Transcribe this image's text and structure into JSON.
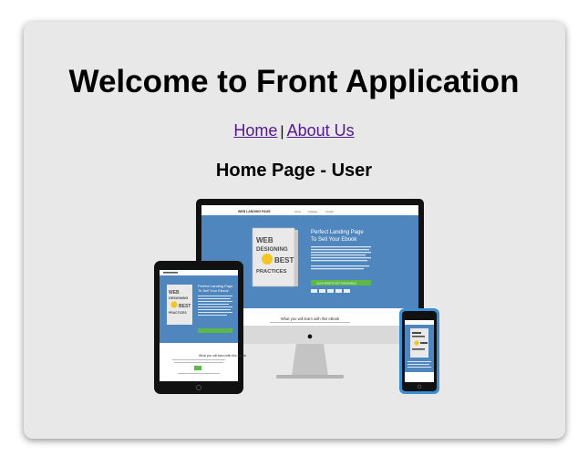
{
  "header": {
    "title": "Welcome to Front Application"
  },
  "nav": {
    "links": [
      {
        "label": "Home"
      },
      {
        "label": "About Us"
      }
    ],
    "separator": "|"
  },
  "main": {
    "subtitle": "Home Page - User",
    "image": {
      "desktop": {
        "site_name": "WEB LANDING PAGE",
        "nav_items": [
          "Home",
          "Features",
          "Contact"
        ],
        "hero_heading_line1": "Perfect Landing Page",
        "hero_heading_line2": "To Sell Your Ebook",
        "cta_label": "CLICK HERE TO GET THIS BUNDLE",
        "section_heading": "What you will learn with this eBook"
      },
      "book": {
        "line1": "WEB",
        "line2": "DESIGNING",
        "line3": "BEST",
        "line4": "PRACTICES"
      },
      "tablet": {
        "hero_heading_line1": "Perfect Landing Page",
        "hero_heading_line2": "To Sell Your Ebook",
        "section_heading": "What you will learn with this eBook"
      }
    }
  },
  "colors": {
    "link": "#551a8b",
    "card_bg": "#e8e8e8",
    "site_blue": "#4f86bd",
    "cta_green": "#5cb947"
  }
}
